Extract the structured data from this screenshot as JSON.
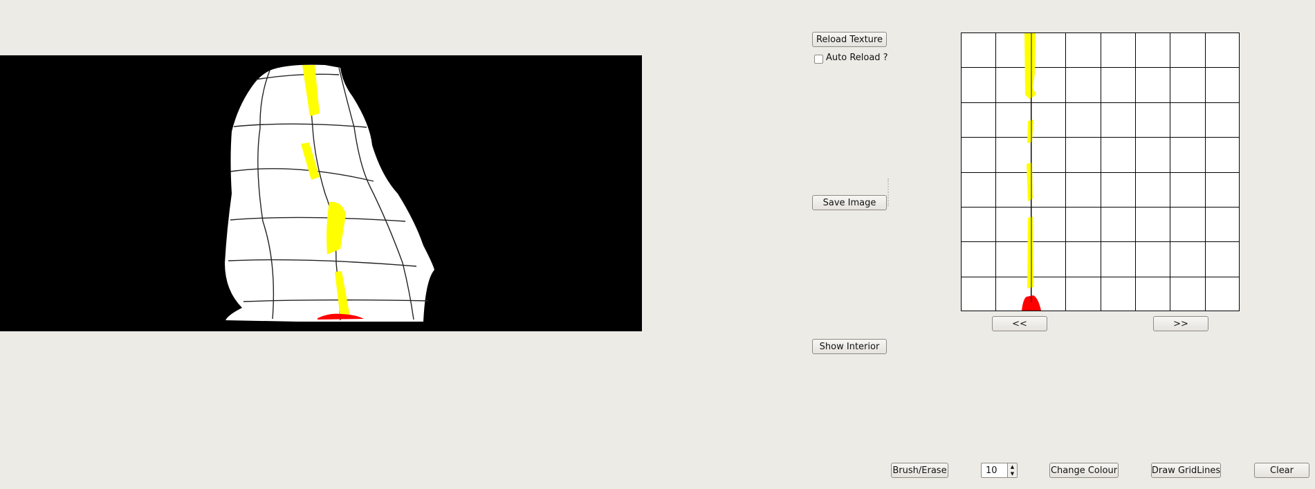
{
  "controls": {
    "reload_texture": "Reload Texture",
    "auto_reload": "Auto Reload ?",
    "auto_reload_checked": false,
    "save_image": "Save Image",
    "show_interior": "Show Interior",
    "prev": "<<",
    "next": ">>"
  },
  "toolbar": {
    "brush_erase": "Brush/Erase",
    "brush_size": "10",
    "change_colour": "Change Colour",
    "draw_gridlines": "Draw GridLines",
    "clear": "Clear"
  },
  "colors": {
    "background": "#edebe6",
    "viewport_bg": "#000000",
    "paint_primary": "#ffff00",
    "paint_secondary": "#ff0000",
    "grid_line": "#000000"
  },
  "texture_grid": {
    "columns": 8,
    "rows": 8
  },
  "icons": {
    "spin_up": "up-arrow-icon",
    "spin_down": "down-arrow-icon"
  }
}
